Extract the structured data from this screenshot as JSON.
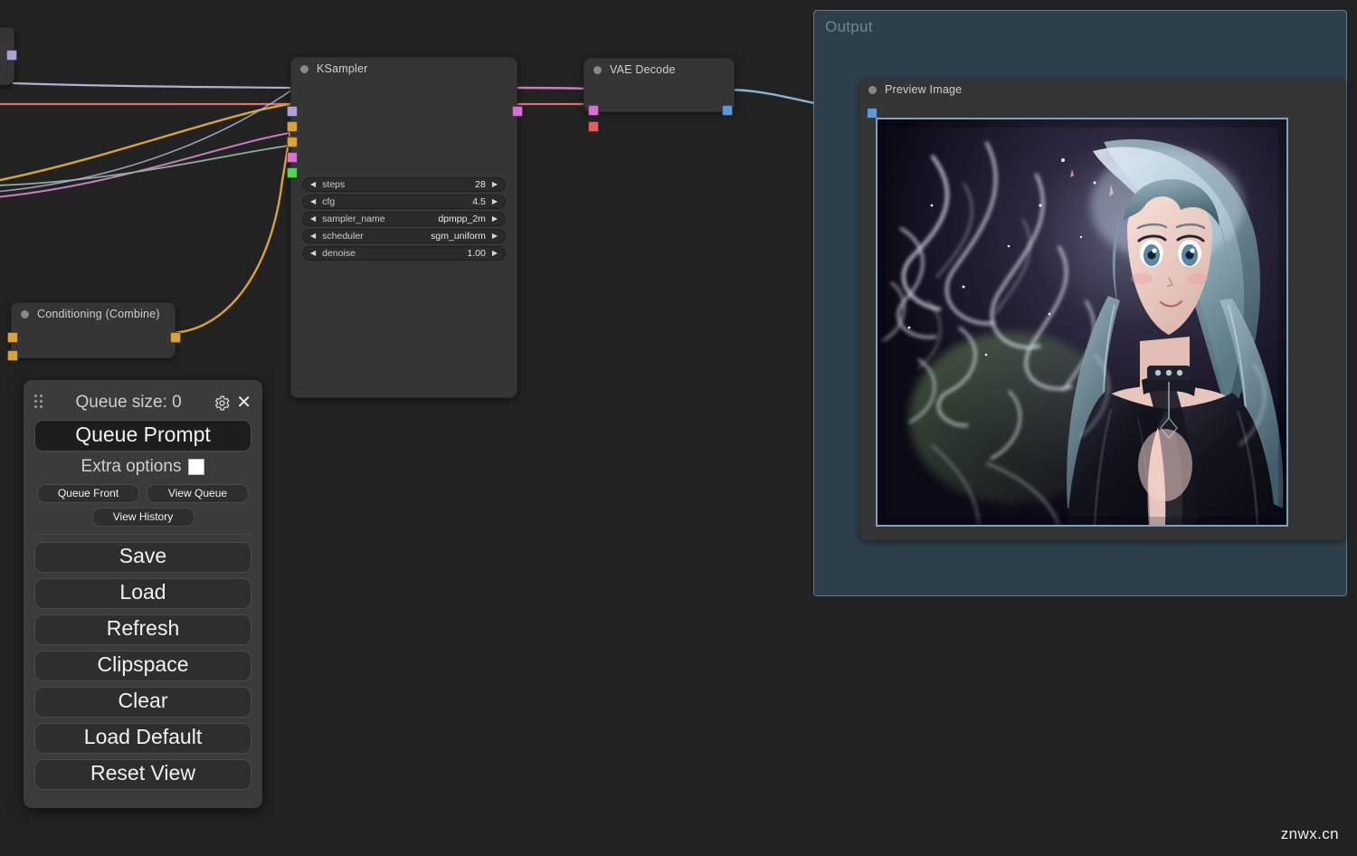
{
  "canvas": {
    "background": "#222222"
  },
  "nodes": {
    "partial_left": {
      "title": "",
      "output_slot_color": "#b0a0d8"
    },
    "conditioning_combine": {
      "title": "Conditioning (Combine)",
      "input_slot_color": "#d9a338",
      "output_slot_color": "#d9a338"
    },
    "ksampler": {
      "title": "KSampler",
      "input_slot_colors": [
        "#b0a0d8",
        "#d9a338",
        "#d9a338",
        "#d66fd6",
        "#53d453"
      ],
      "output_slot_color": "#d66fd6",
      "widgets": [
        {
          "name": "steps",
          "value": "28"
        },
        {
          "name": "cfg",
          "value": "4.5"
        },
        {
          "name": "sampler_name",
          "value": "dpmpp_2m"
        },
        {
          "name": "scheduler",
          "value": "sgm_uniform"
        },
        {
          "name": "denoise",
          "value": "1.00"
        }
      ],
      "left_arrow": "◀",
      "right_arrow": "▶"
    },
    "vae_decode": {
      "title": "VAE Decode",
      "input_slot_colors": [
        "#d66fd6",
        "#e06060"
      ],
      "output_slot_color": "#5b9bd5"
    },
    "preview_image": {
      "title": "Preview Image",
      "input_slot_color": "#5b9bd5",
      "image_alt": "anime woman with flowing ethereal white-teal hair, dark glossy jacket, purple-black background"
    }
  },
  "group": {
    "title": "Output",
    "fill": "#2d3f4b",
    "border": "#5e7a8c"
  },
  "menu": {
    "queue_size_label": "Queue size: 0",
    "gear_tooltip": "Settings",
    "close_label": "✕",
    "queue_prompt_label": "Queue Prompt",
    "extra_options_label": "Extra options",
    "extra_options_checked": false,
    "queue_front_label": "Queue Front",
    "view_queue_label": "View Queue",
    "view_history_label": "View History",
    "buttons": [
      {
        "label": "Save"
      },
      {
        "label": "Load"
      },
      {
        "label": "Refresh"
      },
      {
        "label": "Clipspace"
      },
      {
        "label": "Clear"
      },
      {
        "label": "Load Default"
      },
      {
        "label": "Reset View"
      }
    ]
  },
  "watermark": {
    "text": "znwx.cn"
  }
}
